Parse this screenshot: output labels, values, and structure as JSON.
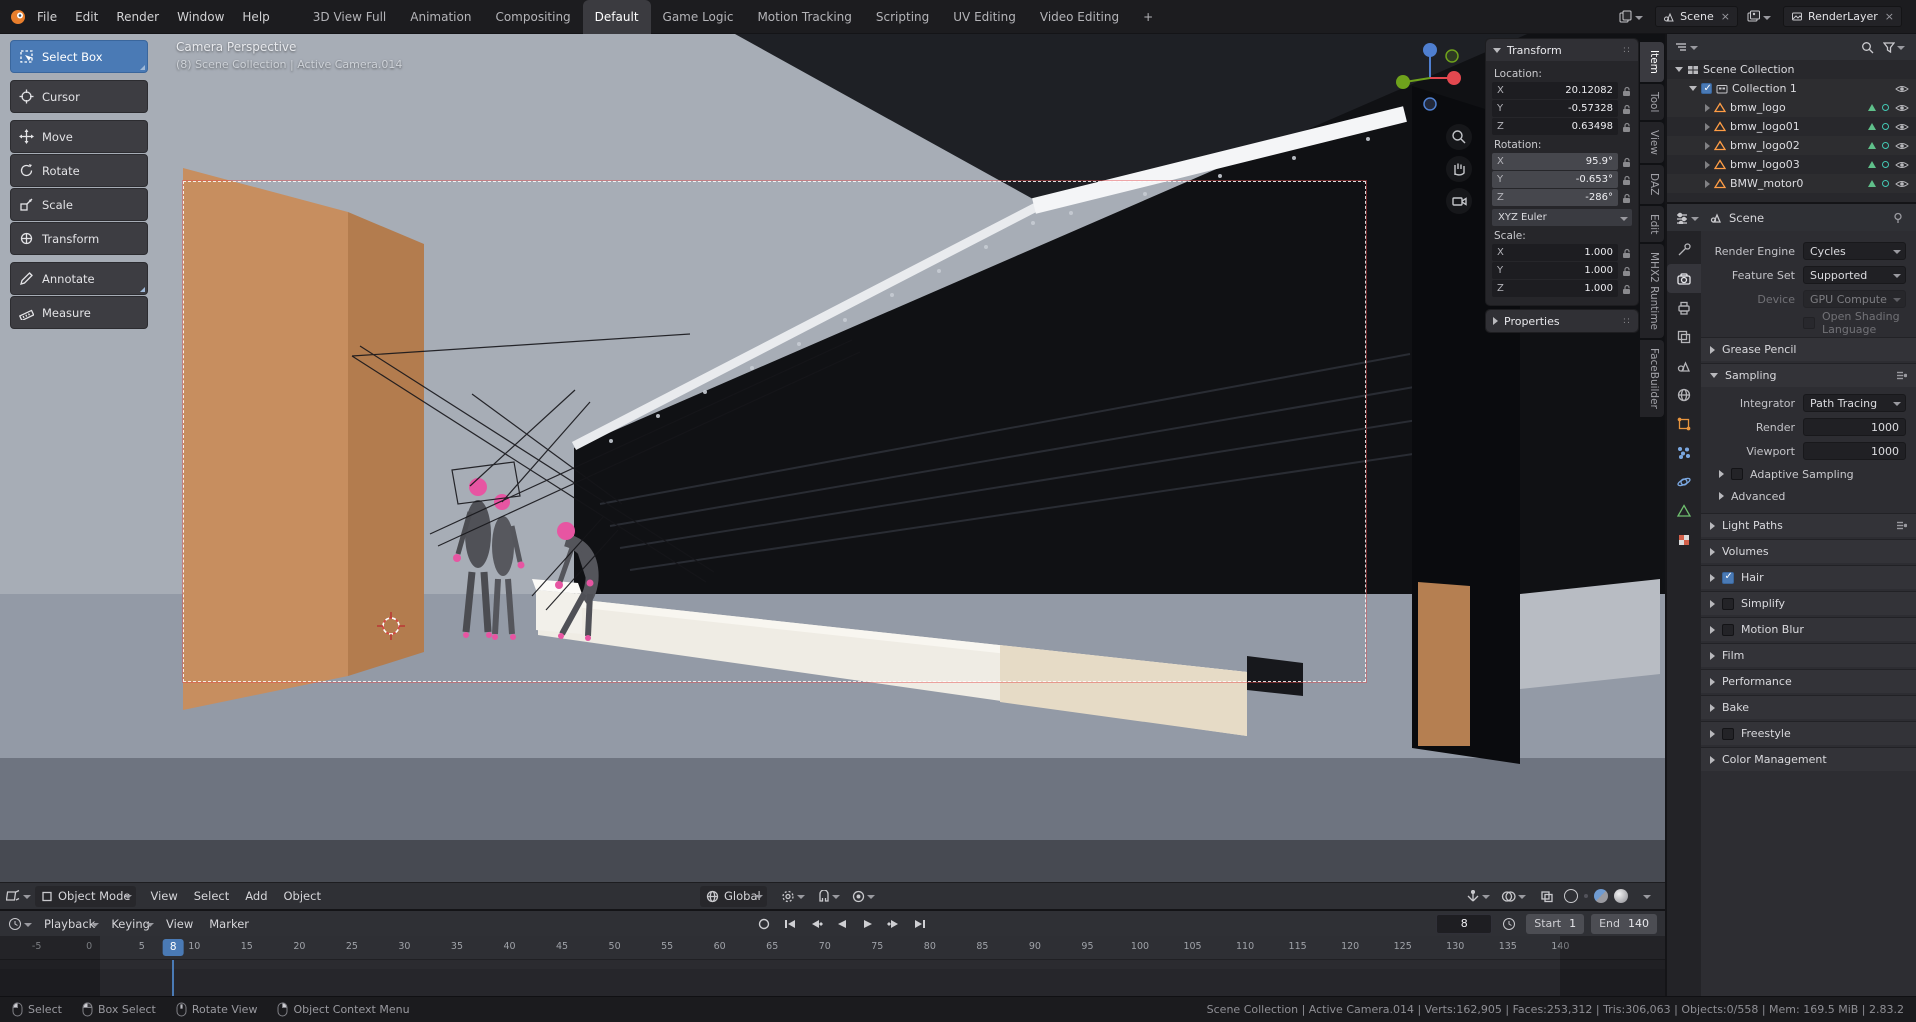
{
  "colors": {
    "accent_blue": "#4a7ab5",
    "object_orange": "#ff9d45",
    "mannequin_pink": "#e755a2"
  },
  "icons": {
    "close": "×",
    "grip": "::"
  },
  "topbar": {
    "menus": [
      "File",
      "Edit",
      "Render",
      "Window",
      "Help"
    ],
    "workspaces": [
      {
        "label": "3D View Full"
      },
      {
        "label": "Animation"
      },
      {
        "label": "Compositing"
      },
      {
        "label": "Default",
        "active": true
      },
      {
        "label": "Game Logic"
      },
      {
        "label": "Motion Tracking"
      },
      {
        "label": "Scripting"
      },
      {
        "label": "UV Editing"
      },
      {
        "label": "Video Editing"
      },
      {
        "label": "+"
      }
    ],
    "scene_name": "Scene",
    "render_layer": "RenderLayer"
  },
  "toolbar": {
    "tools": [
      {
        "label": "Select Box",
        "active": true
      },
      {
        "label": "Cursor"
      },
      {
        "label": "Move"
      },
      {
        "label": "Rotate"
      },
      {
        "label": "Scale"
      },
      {
        "label": "Transform"
      },
      {
        "label": "Annotate"
      },
      {
        "label": "Measure"
      }
    ]
  },
  "viewport": {
    "overlay_line1": "Camera Perspective",
    "overlay_line2": "(8) Scene Collection | Active Camera.014"
  },
  "npanel": {
    "transform_title": "Transform",
    "location_label": "Location:",
    "location": [
      {
        "axis": "X",
        "value": "20.12082"
      },
      {
        "axis": "Y",
        "value": "-0.57328"
      },
      {
        "axis": "Z",
        "value": "0.63498"
      }
    ],
    "rotation_label": "Rotation:",
    "rotation": [
      {
        "axis": "X",
        "value": "95.9°"
      },
      {
        "axis": "Y",
        "value": "-0.653°"
      },
      {
        "axis": "Z",
        "value": "-286°"
      }
    ],
    "rotation_mode": "XYZ Euler",
    "scale_label": "Scale:",
    "scale": [
      {
        "axis": "X",
        "value": "1.000"
      },
      {
        "axis": "Y",
        "value": "1.000"
      },
      {
        "axis": "Z",
        "value": "1.000"
      }
    ],
    "properties_title": "Properties",
    "tabs": [
      {
        "label": "Item",
        "active": true
      },
      {
        "label": "Tool"
      },
      {
        "label": "View"
      },
      {
        "label": "DAZ"
      },
      {
        "label": "Edit"
      },
      {
        "label": "MHX2 Runtime"
      },
      {
        "label": "FaceBuilder"
      }
    ]
  },
  "viewport_header": {
    "mode": "Object Mode",
    "menus": [
      "View",
      "Select",
      "Add",
      "Object"
    ],
    "orientation": "Global"
  },
  "timeline": {
    "menus": [
      "Playback",
      "Keying",
      "View",
      "Marker"
    ],
    "frame": "8",
    "start_label": "Start",
    "start": "1",
    "end_label": "End",
    "end": "140",
    "ticks": [
      "-5",
      "0",
      "5",
      "10",
      "15",
      "20",
      "25",
      "30",
      "35",
      "40",
      "45",
      "50",
      "55",
      "60",
      "65",
      "70",
      "75",
      "80",
      "85",
      "90",
      "95",
      "100",
      "105",
      "110",
      "115",
      "120",
      "125",
      "130",
      "135",
      "140"
    ]
  },
  "outliner": {
    "root": "Scene Collection",
    "collection": "Collection 1",
    "objects": [
      "bmw_logo",
      "bmw_logo01",
      "bmw_logo02",
      "bmw_logo03",
      "BMW_motor0"
    ]
  },
  "properties": {
    "breadcrumb": "Scene",
    "engine_rows": [
      {
        "label": "Render Engine",
        "value": "Cycles"
      },
      {
        "label": "Feature Set",
        "value": "Supported"
      },
      {
        "label": "Device",
        "value": "GPU Compute",
        "dim": true
      }
    ],
    "osl_label": "Open Shading Language",
    "grease_pencil": "Grease Pencil",
    "sampling_title": "Sampling",
    "integrator_label": "Integrator",
    "integrator": "Path Tracing",
    "render_label": "Render",
    "render_samples": "1000",
    "viewport_label": "Viewport",
    "viewport_samples": "1000",
    "adaptive_label": "Adaptive Sampling",
    "advanced_label": "Advanced",
    "panels": [
      {
        "label": "Light Paths",
        "preset": true
      },
      {
        "label": "Volumes"
      },
      {
        "label": "Hair",
        "cb": true,
        "checked": true
      },
      {
        "label": "Simplify",
        "cb": true
      },
      {
        "label": "Motion Blur",
        "cb": true
      },
      {
        "label": "Film"
      },
      {
        "label": "Performance"
      },
      {
        "label": "Bake"
      },
      {
        "label": "Freestyle",
        "cb": true
      },
      {
        "label": "Color Management"
      }
    ]
  },
  "statusbar": {
    "hints": [
      "Select",
      "Box Select",
      "Rotate View",
      "Object Context Menu"
    ],
    "stats": "Scene Collection | Active Camera.014 | Verts:162,905 | Faces:253,312 | Tris:306,063 | Objects:0/558 | Mem: 169.5 MiB | 2.83.2"
  }
}
